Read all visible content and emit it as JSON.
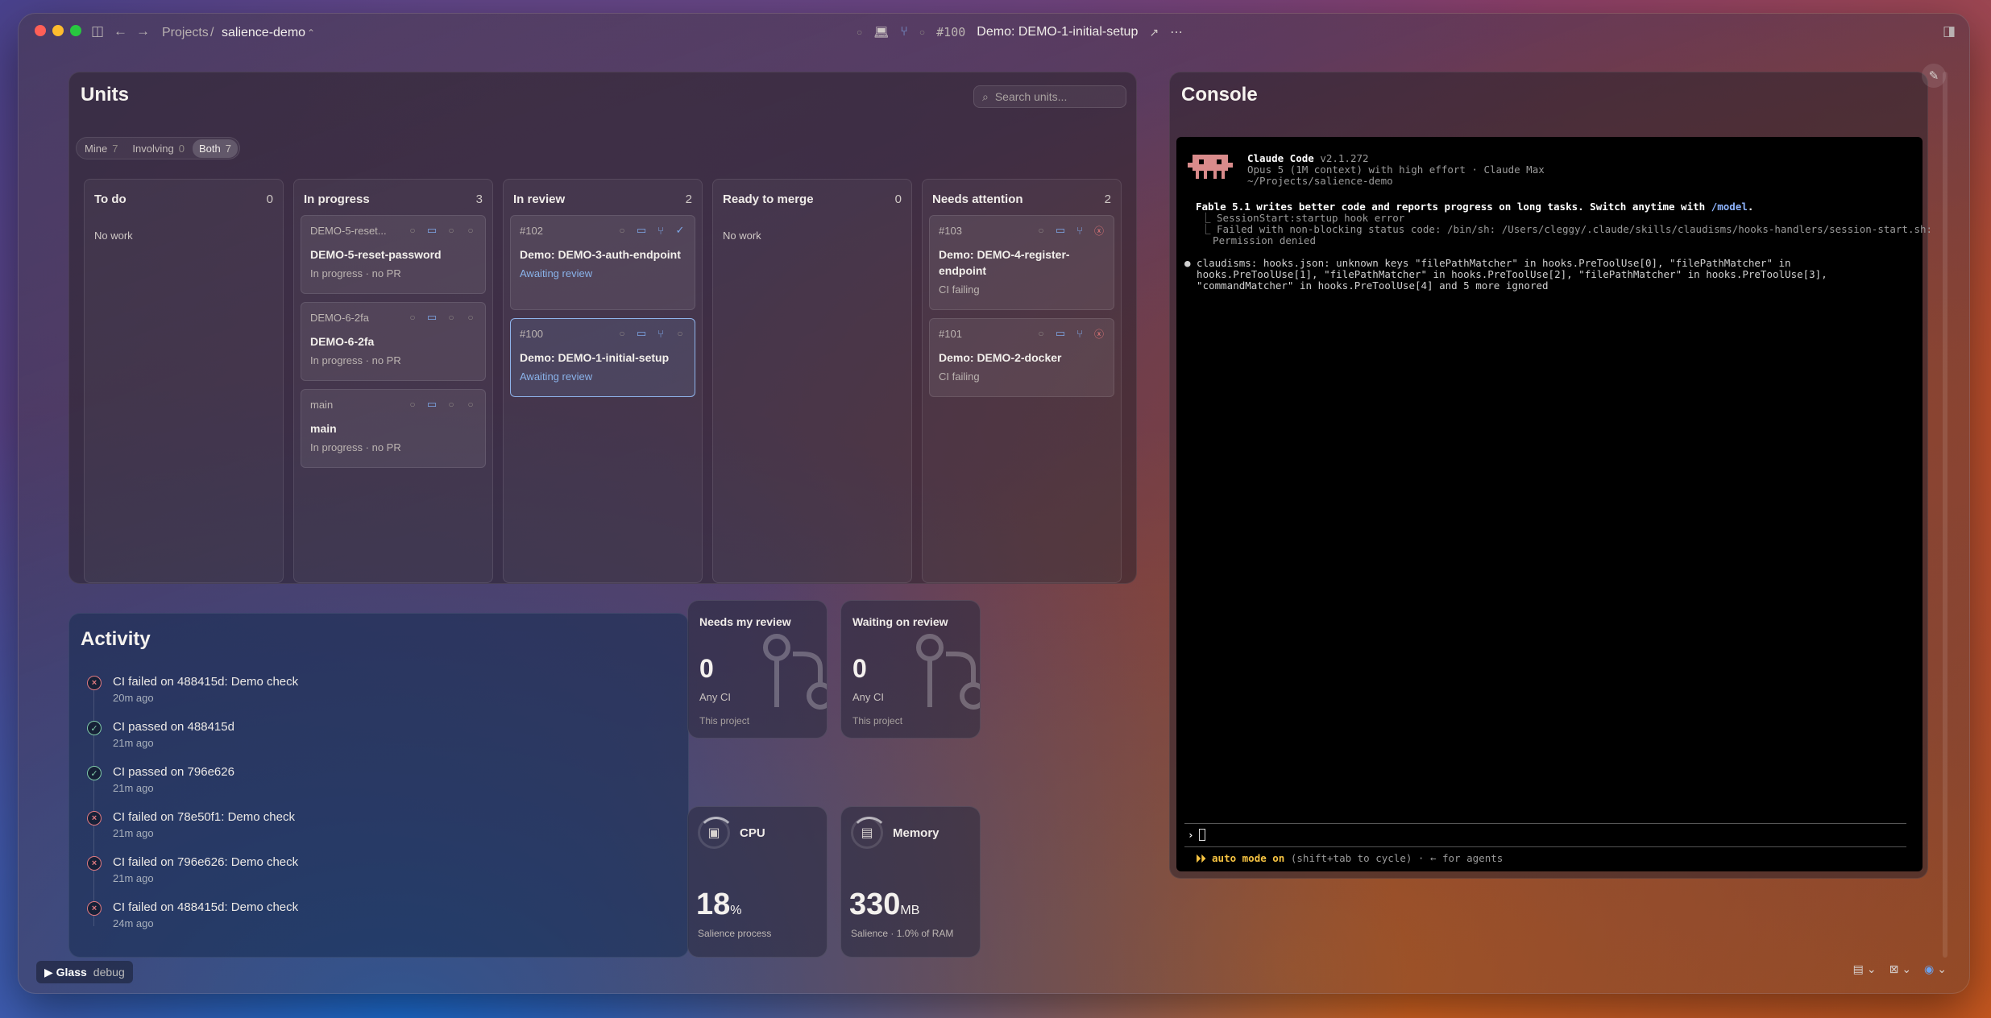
{
  "titlebar": {
    "breadcrumb_root": "Projects",
    "breadcrumb_sep": "/",
    "project": "salience-demo",
    "unit_number": "#100",
    "unit_name": "Demo: DEMO-1-initial-setup"
  },
  "units": {
    "title": "Units",
    "search_placeholder": "Search units...",
    "filters": [
      {
        "label": "Mine",
        "count": "7"
      },
      {
        "label": "Involving",
        "count": "0"
      },
      {
        "label": "Both",
        "count": "7"
      }
    ],
    "no_work": "No work",
    "columns": [
      {
        "title": "To do",
        "count": "0"
      },
      {
        "title": "In progress",
        "count": "3"
      },
      {
        "title": "In review",
        "count": "2"
      },
      {
        "title": "Ready to merge",
        "count": "0"
      },
      {
        "title": "Needs attention",
        "count": "2"
      }
    ],
    "in_progress_cards": [
      {
        "ref": "DEMO-5-reset...",
        "title": "DEMO-5-reset-password",
        "status": "In progress · no PR"
      },
      {
        "ref": "DEMO-6-2fa",
        "title": "DEMO-6-2fa",
        "status": "In progress · no PR"
      },
      {
        "ref": "main",
        "title": "main",
        "status": "In progress · no PR"
      }
    ],
    "in_review_cards": [
      {
        "ref": "#102",
        "title": "Demo: DEMO-3-auth-endpoint",
        "status": "Awaiting review"
      },
      {
        "ref": "#100",
        "title": "Demo: DEMO-1-initial-setup",
        "status": "Awaiting review"
      }
    ],
    "attention_cards": [
      {
        "ref": "#103",
        "title": "Demo: DEMO-4-register-endpoint",
        "status": "CI failing"
      },
      {
        "ref": "#101",
        "title": "Demo: DEMO-2-docker",
        "status": "CI failing"
      }
    ]
  },
  "activity": {
    "title": "Activity",
    "items": [
      {
        "kind": "fail",
        "text": "CI failed on 488415d: Demo check",
        "time": "20m ago"
      },
      {
        "kind": "pass",
        "text": "CI passed on 488415d",
        "time": "21m ago"
      },
      {
        "kind": "pass",
        "text": "CI passed on 796e626",
        "time": "21m ago"
      },
      {
        "kind": "fail",
        "text": "CI failed on 78e50f1: Demo check",
        "time": "21m ago"
      },
      {
        "kind": "fail",
        "text": "CI failed on 796e626: Demo check",
        "time": "21m ago"
      },
      {
        "kind": "fail",
        "text": "CI failed on 488415d: Demo check",
        "time": "24m ago"
      }
    ]
  },
  "review": {
    "needs_title": "Needs my review",
    "needs_value": "0",
    "needs_sub": "Any CI",
    "needs_foot": "This project",
    "waiting_title": "Waiting on review",
    "waiting_value": "0",
    "waiting_sub": "Any CI",
    "waiting_foot": "This project"
  },
  "resources": {
    "cpu_title": "CPU",
    "cpu_value": "18",
    "cpu_unit": "%",
    "cpu_foot": "Salience process",
    "cpu_fraction": 0.18,
    "mem_title": "Memory",
    "mem_value": "330",
    "mem_unit": "MB",
    "mem_foot": "Salience · 1.0% of RAM"
  },
  "console": {
    "title": "Console",
    "app_name": "Claude Code",
    "version": "v2.1.272",
    "model_line": "Opus 5 (1M context) with high effort · Claude Max",
    "cwd": "~/Projects/salience-demo",
    "notice": "Fable 5.1 writes better code and reports progress on long tasks. Switch anytime with ",
    "notice_cmd": "/model",
    "notice_end": ".",
    "hook_1": "⎿ SessionStart:startup hook error",
    "hook_2": "⎿ Failed with non-blocking status code: /bin/sh: /Users/cleggy/.claude/skills/claudisms/hooks-handlers/session-start.sh:",
    "hook_3": "  Permission denied",
    "warn_1": "● claudisms: hooks.json: unknown keys \"filePathMatcher\" in hooks.PreToolUse[0], \"filePathMatcher\" in",
    "warn_2": "  hooks.PreToolUse[1], \"filePathMatcher\" in hooks.PreToolUse[2], \"filePathMatcher\" in hooks.PreToolUse[3],",
    "warn_3": "  \"commandMatcher\" in hooks.PreToolUse[4] and 5 more ignored",
    "prompt": "›",
    "auto_on": "⏵⏵ auto mode on",
    "auto_rest": " (shift+tab to cycle) · ← for agents"
  },
  "footer": {
    "glass_label": "▶ Glass",
    "debug_label": "debug"
  },
  "colors": {
    "accent_blue": "#8ab3ea",
    "fail_red": "#e07a80",
    "pass_green": "#7fc9a8",
    "auto_yellow": "#f6c342"
  }
}
